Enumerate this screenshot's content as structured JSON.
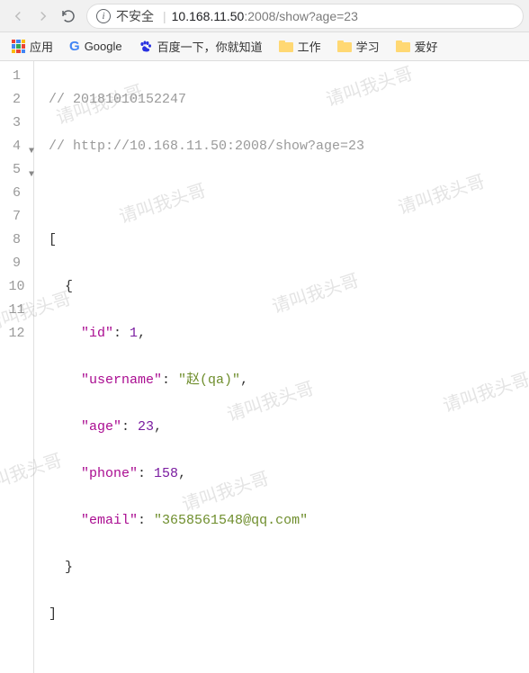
{
  "nav": {
    "insecure_label": "不安全",
    "url_host": "10.168.11.50",
    "url_port": ":2008",
    "url_path": "/show?age=23"
  },
  "bookmarks": {
    "apps": "应用",
    "items": [
      {
        "label": "Google"
      },
      {
        "label": "百度一下，你就知道"
      },
      {
        "label": "工作"
      },
      {
        "label": "学习"
      },
      {
        "label": "爱好"
      }
    ]
  },
  "code": {
    "comment1": "// 20181010152247",
    "comment2": "// http://10.168.11.50:2008/show?age=23",
    "open_arr": "[",
    "open_obj": "{",
    "k_id": "\"id\"",
    "v_id": "1",
    "k_user": "\"username\"",
    "v_user": "\"赵(qa)\"",
    "k_age": "\"age\"",
    "v_age": "23",
    "k_phone": "\"phone\"",
    "v_phone": "158",
    "k_email": "\"email\"",
    "v_email": "\"3658561548@qq.com\"",
    "close_obj": "}",
    "close_arr": "]"
  },
  "watermark": "请叫我头哥"
}
